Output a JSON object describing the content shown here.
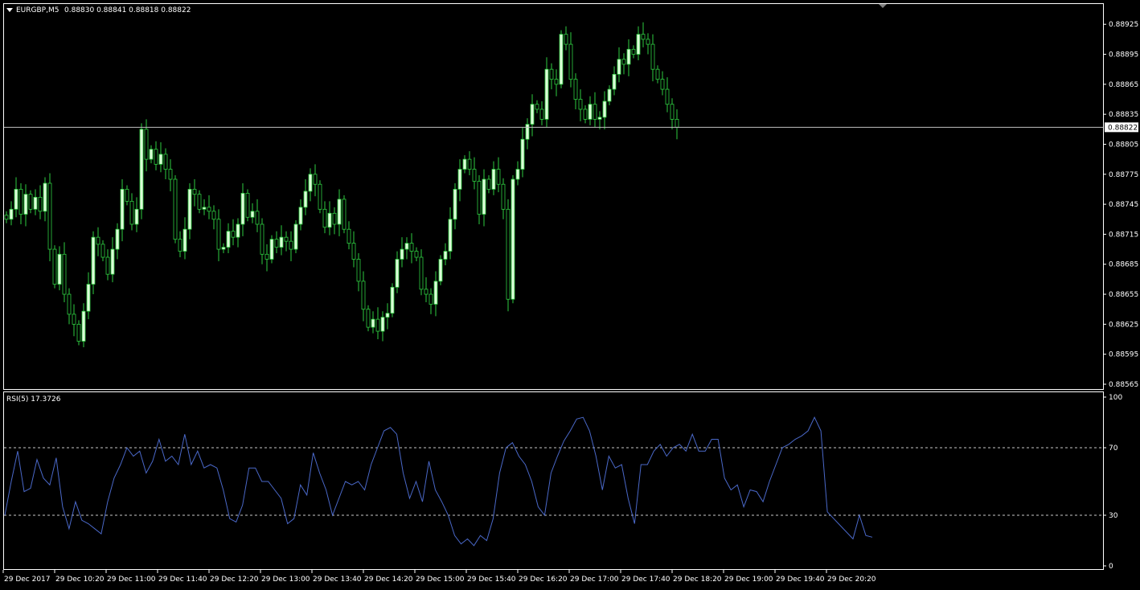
{
  "colors": {
    "background": "#000000",
    "frame": "#ffffff",
    "up_candle": "#dcfcd8",
    "down_candle": "#000000",
    "wick": "#2ecc40",
    "rsi_line": "#4a68c8",
    "text": "#ffffff"
  },
  "header": {
    "arrow_icon": "triangle-down-icon",
    "symbol_label": "EURGBP,M5",
    "ohlc_text": "0.88830 0.88841 0.88818 0.88822"
  },
  "rsi_panel": {
    "label": "RSI(5) 17.3726"
  },
  "current_price_label": "0.88822",
  "chart_data": [
    {
      "type": "candlestick",
      "title": "EURGBP,M5",
      "y_ticks": [
        "0.88925",
        "0.88895",
        "0.88865",
        "0.88835",
        "0.88805",
        "0.88775",
        "0.88745",
        "0.88715",
        "0.88685",
        "0.88655",
        "0.88625",
        "0.88595",
        "0.88565"
      ],
      "ylim": [
        0.88565,
        0.8893
      ],
      "current_price": 0.88822,
      "x_ticks": [
        "29 Dec 2017",
        "29 Dec 10:20",
        "29 Dec 11:00",
        "29 Dec 11:40",
        "29 Dec 12:20",
        "29 Dec 13:00",
        "29 Dec 13:40",
        "29 Dec 14:20",
        "29 Dec 15:00",
        "29 Dec 15:40",
        "29 Dec 16:20",
        "29 Dec 17:00",
        "29 Dec 17:40",
        "29 Dec 18:20",
        "29 Dec 19:00",
        "29 Dec 19:40",
        "29 Dec 20:20"
      ],
      "closes": [
        0.8873,
        0.8874,
        0.8876,
        0.88735,
        0.88755,
        0.8874,
        0.88752,
        0.88738,
        0.88766,
        0.887,
        0.88665,
        0.88695,
        0.88655,
        0.88635,
        0.88625,
        0.88608,
        0.88638,
        0.88665,
        0.88712,
        0.88705,
        0.88692,
        0.88675,
        0.887,
        0.8872,
        0.8876,
        0.88748,
        0.88725,
        0.8874,
        0.8882,
        0.8879,
        0.888,
        0.88785,
        0.88795,
        0.8878,
        0.8877,
        0.8871,
        0.88698,
        0.8872,
        0.8876,
        0.88755,
        0.8874,
        0.88742,
        0.88738,
        0.8873,
        0.887,
        0.88702,
        0.88718,
        0.88712,
        0.88725,
        0.88756,
        0.88732,
        0.88738,
        0.88725,
        0.88695,
        0.8869,
        0.8871,
        0.88702,
        0.88712,
        0.88708,
        0.887,
        0.88725,
        0.88742,
        0.88758,
        0.88775,
        0.88765,
        0.8874,
        0.88722,
        0.88736,
        0.88725,
        0.8875,
        0.8872,
        0.88706,
        0.8869,
        0.88668,
        0.8864,
        0.88622,
        0.8863,
        0.88618,
        0.88632,
        0.88636,
        0.88662,
        0.8869,
        0.887,
        0.88706,
        0.88698,
        0.88692,
        0.8866,
        0.88655,
        0.88645,
        0.88668,
        0.8869,
        0.88698,
        0.8873,
        0.8876,
        0.8878,
        0.8879,
        0.8878,
        0.88768,
        0.88735,
        0.8877,
        0.8876,
        0.8878,
        0.88765,
        0.8874,
        0.8865,
        0.8877,
        0.8878,
        0.8881,
        0.88825,
        0.88845,
        0.8884,
        0.8883,
        0.8888,
        0.8887,
        0.88865,
        0.88915,
        0.88905,
        0.8887,
        0.8885,
        0.8884,
        0.8883,
        0.88845,
        0.8883,
        0.88832,
        0.88848,
        0.8886,
        0.88875,
        0.8889,
        0.88885,
        0.889,
        0.88895,
        0.88915,
        0.8891,
        0.88905,
        0.8888,
        0.8887,
        0.8886,
        0.88845,
        0.8883,
        0.88822
      ]
    },
    {
      "type": "line",
      "title": "RSI(5) 17.3726",
      "y_ticks": [
        "100",
        "70",
        "30",
        "0"
      ],
      "ylim": [
        0,
        100
      ],
      "levels": [
        70,
        30
      ],
      "series": [
        {
          "values": [
            30,
            50,
            68,
            44,
            46,
            63,
            52,
            48,
            64,
            35,
            22,
            38,
            27,
            25,
            22,
            19,
            38,
            52,
            60,
            70,
            65,
            68,
            55,
            62,
            75,
            62,
            65,
            60,
            78,
            60,
            68,
            58,
            60,
            58,
            45,
            28,
            26,
            36,
            58,
            58,
            50,
            50,
            45,
            40,
            25,
            28,
            48,
            42,
            67,
            55,
            45,
            30,
            40,
            50,
            48,
            50,
            45,
            60,
            70,
            80,
            82,
            78,
            55,
            40,
            50,
            38,
            62,
            45,
            38,
            30,
            18,
            13,
            16,
            12,
            18,
            15,
            28,
            55,
            70,
            73,
            65,
            60,
            50,
            35,
            30,
            55,
            65,
            74,
            80,
            87,
            88,
            80,
            65,
            45,
            65,
            58,
            60,
            40,
            25,
            60,
            60,
            68,
            72,
            65,
            70,
            72,
            68,
            78,
            68,
            68,
            75,
            75,
            52,
            45,
            48,
            35,
            45,
            44,
            38,
            50,
            60,
            70,
            72,
            75,
            77,
            80,
            88,
            80,
            32,
            28,
            24,
            20,
            16,
            30,
            18,
            17
          ]
        }
      ]
    }
  ]
}
